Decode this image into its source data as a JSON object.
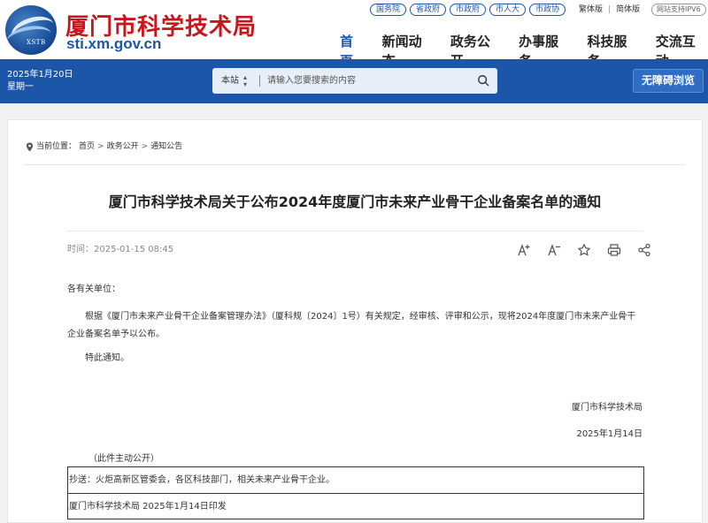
{
  "header": {
    "logo_text": "XSTB",
    "site_title": "厦门市科学技术局",
    "site_domain": "sti.xm.gov.cn",
    "top_links": [
      "国务院",
      "省政府",
      "市政府",
      "市人大",
      "市政协"
    ],
    "lang_traditional": "繁体版",
    "lang_simplified": "简体版",
    "ipv6": "网站支持IPV6",
    "nav": [
      {
        "label": "首页",
        "active": true
      },
      {
        "label": "新闻动态",
        "active": false
      },
      {
        "label": "政务公开",
        "active": false
      },
      {
        "label": "办事服务",
        "active": false
      },
      {
        "label": "科技服务",
        "active": false
      },
      {
        "label": "交流互动",
        "active": false
      }
    ]
  },
  "bar": {
    "date": "2025年1月20日",
    "weekday": "星期一",
    "search_scope": "本站",
    "search_placeholder": "请输入您要搜索的内容",
    "accessible_button": "无障碍浏览"
  },
  "breadcrumb": {
    "label": "当前位置：",
    "items": [
      "首页",
      "政务公开",
      "通知公告"
    ],
    "separator": ">"
  },
  "article": {
    "title": "厦门市科学技术局关于公布2024年度厦门市未来产业骨干企业备案名单的通知",
    "time_label": "时间：",
    "time": "2025-01-15 08:45",
    "greeting": "各有关单位：",
    "paragraph": "根据《厦门市未来产业骨干企业备案管理办法》（厦科规〔2024〕1号）有关规定，经审核、评审和公示，现将2024年度厦门市未来产业骨干企业备案名单予以公布。",
    "notice": "特此通知。",
    "sign_org": "厦门市科学技术局",
    "sign_date": "2025年1月14日",
    "public_note": "（此件主动公开）",
    "cc": "抄送：火炬高新区管委会，各区科技部门，相关未来产业骨干企业。",
    "print_info": "厦门市科学技术局  2025年1月14日印发"
  },
  "colors": {
    "brand_blue": "#1c56a8",
    "title_red": "#c8161d"
  }
}
